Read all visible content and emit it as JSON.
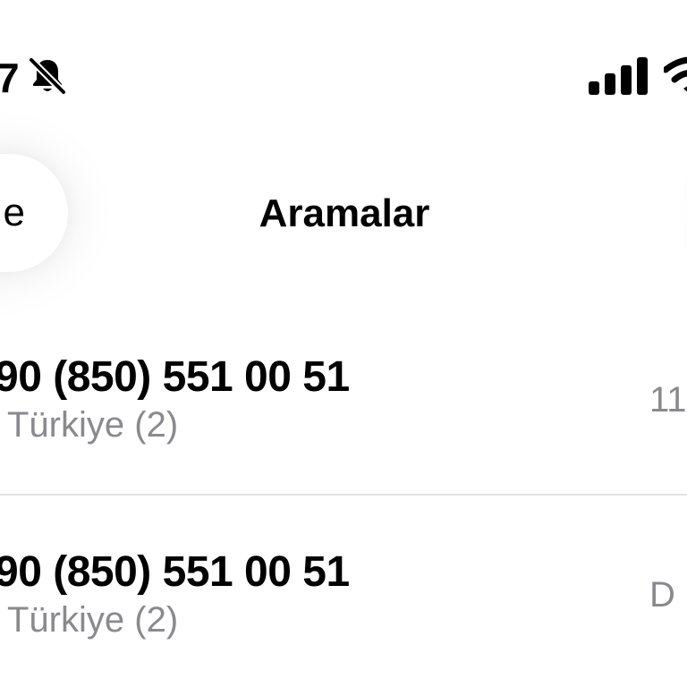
{
  "status_bar": {
    "time": "7",
    "icons": [
      "bell-slash-icon",
      "cellular-signal-icon",
      "wifi-icon"
    ]
  },
  "nav": {
    "back_label": "e",
    "title": "Aramalar"
  },
  "calls": [
    {
      "number": "90 (850) 551 00 51",
      "label": "Türkiye (2)",
      "time": "11"
    },
    {
      "number": "90 (850) 551 00 51",
      "label": "Türkiye (2)",
      "time": "D"
    }
  ],
  "colors": {
    "background": "#ffffff",
    "text": "#000000",
    "secondary_text": "#8a8a8e",
    "separator": "#e2e2e4"
  }
}
